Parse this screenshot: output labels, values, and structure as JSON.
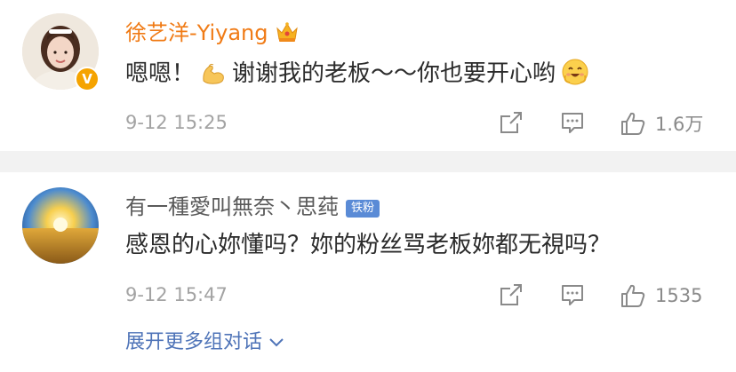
{
  "comments": [
    {
      "username": "徐艺洋-Yiyang",
      "text_before": "嗯嗯！",
      "text_middle": "谢谢我的老板～～你也要开心哟",
      "time": "9-12 15:25",
      "likes": "1.6万",
      "username_color": "#f07b16",
      "badge_icon": "crown-icon",
      "emojis": [
        "flexed-biceps-emoji",
        "smiling-face-emoji"
      ]
    },
    {
      "username": "有一種愛叫無奈丶思莼",
      "fan_badge": "铁粉",
      "text": "感恩的心妳懂吗？妳的粉丝骂老板妳都无視吗？",
      "time": "9-12 15:47",
      "likes": "1535"
    }
  ],
  "expand_label": "展开更多组对话",
  "accent_link_color": "#4f74b8"
}
